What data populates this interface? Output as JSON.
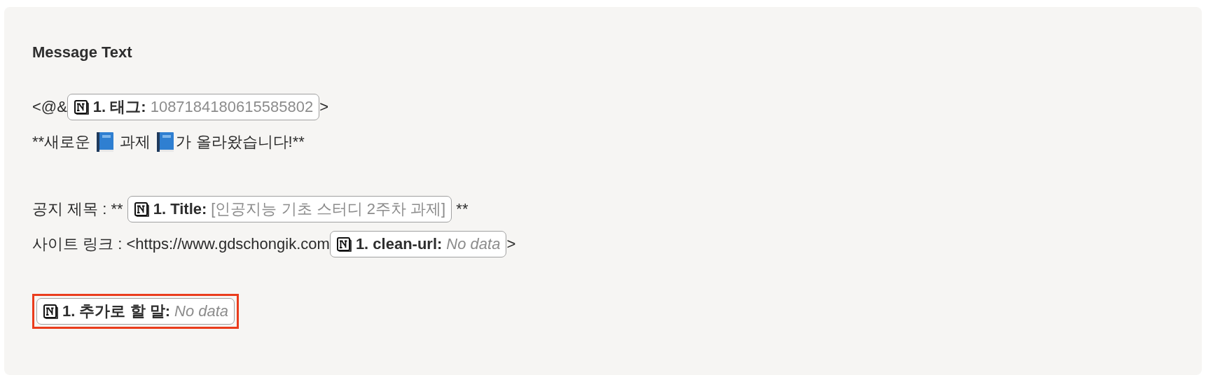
{
  "field": {
    "label": "Message Text",
    "lines": [
      {
        "kind": "line",
        "segments": [
          {
            "kind": "text",
            "text": "<@&"
          },
          {
            "kind": "pill",
            "label": "1. 태그:",
            "value": "1087184180615585802",
            "missing": false,
            "highlighted": false
          },
          {
            "kind": "text",
            "text": ">"
          }
        ]
      },
      {
        "kind": "line",
        "segments": [
          {
            "kind": "text",
            "text": "**새로운 "
          },
          {
            "kind": "book"
          },
          {
            "kind": "text",
            "text": " 과제 "
          },
          {
            "kind": "book"
          },
          {
            "kind": "text",
            "text": "가 올라왔습니다!**"
          }
        ]
      },
      {
        "kind": "blank"
      },
      {
        "kind": "line",
        "segments": [
          {
            "kind": "text",
            "text": "공지 제목 : ** "
          },
          {
            "kind": "pill",
            "label": "1. Title:",
            "value": "[인공지능 기초 스터디 2주차 과제]",
            "missing": false,
            "highlighted": false
          },
          {
            "kind": "text",
            "text": " **"
          }
        ]
      },
      {
        "kind": "line",
        "segments": [
          {
            "kind": "text",
            "text": "사이트 링크 : <https://www.gdschongik.com"
          },
          {
            "kind": "pill",
            "label": "1. clean-url:",
            "value": "No data",
            "missing": true,
            "highlighted": false
          },
          {
            "kind": "text",
            "text": ">"
          }
        ]
      },
      {
        "kind": "blank"
      },
      {
        "kind": "line",
        "segments": [
          {
            "kind": "pill",
            "label": "1. 추가로 할 말:",
            "value": "No data",
            "missing": true,
            "highlighted": true
          }
        ]
      }
    ]
  }
}
